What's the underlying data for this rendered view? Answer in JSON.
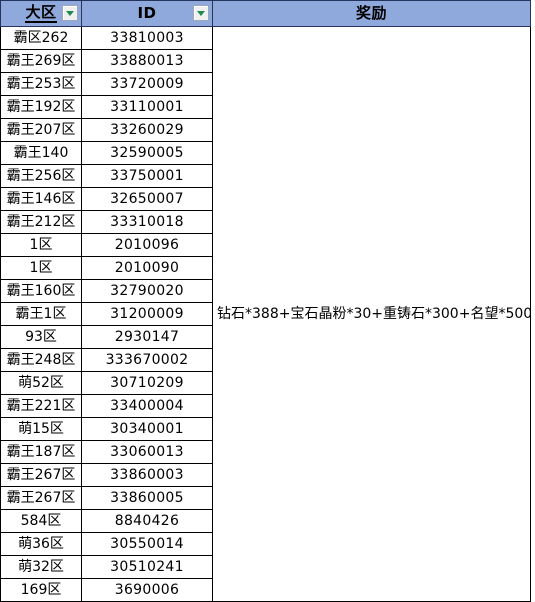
{
  "table": {
    "headers": {
      "region": "大区",
      "id": "ID",
      "reward": "奖励"
    },
    "filter_icon": "filter-dropdown-icon",
    "header_background": "#8FA9DC",
    "grid_line_color": "#000000",
    "rows": [
      {
        "region": "霸区262",
        "id": "33810003"
      },
      {
        "region": "霸王269区",
        "id": "33880013"
      },
      {
        "region": "霸王253区",
        "id": "33720009"
      },
      {
        "region": "霸王192区",
        "id": "33110001"
      },
      {
        "region": "霸王207区",
        "id": "33260029"
      },
      {
        "region": "霸王140",
        "id": "32590005"
      },
      {
        "region": "霸王256区",
        "id": "33750001"
      },
      {
        "region": "霸王146区",
        "id": "32650007"
      },
      {
        "region": "霸王212区",
        "id": "33310018"
      },
      {
        "region": "1区",
        "id": "2010096"
      },
      {
        "region": "1区",
        "id": "2010090"
      },
      {
        "region": "霸王160区",
        "id": "32790020"
      },
      {
        "region": "霸王1区",
        "id": "31200009"
      },
      {
        "region": "93区",
        "id": "2930147"
      },
      {
        "region": "霸王248区",
        "id": "333670002"
      },
      {
        "region": "萌52区",
        "id": "30710209"
      },
      {
        "region": "霸王221区",
        "id": "33400004"
      },
      {
        "region": "萌15区",
        "id": "30340001"
      },
      {
        "region": "霸王187区",
        "id": "33060013"
      },
      {
        "region": "霸王267区",
        "id": "33860003"
      },
      {
        "region": "霸王267区",
        "id": "33860005"
      },
      {
        "region": "584区",
        "id": "8840426"
      },
      {
        "region": "萌36区",
        "id": "30550014"
      },
      {
        "region": "萌32区",
        "id": "30510241"
      },
      {
        "region": "169区",
        "id": "3690006"
      }
    ],
    "reward_value": "钻石*388+宝石晶粉*30+重铸石*300+名望*500"
  }
}
